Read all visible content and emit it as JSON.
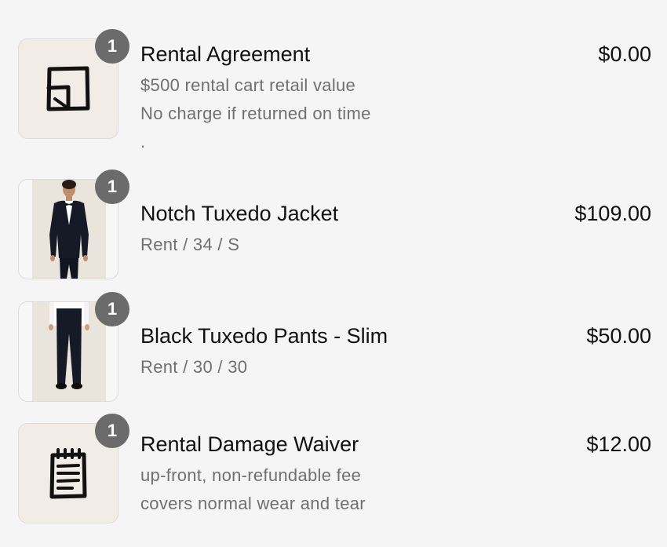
{
  "cart": {
    "items": [
      {
        "quantity": "1",
        "title": "Rental Agreement",
        "details": [
          "$500 rental cart retail value",
          "No charge if returned on time",
          "."
        ],
        "price": "$0.00",
        "thumbnail_icon": "document-corner-icon"
      },
      {
        "quantity": "1",
        "title": "Notch Tuxedo Jacket",
        "details": [
          "Rent / 34 / S"
        ],
        "price": "$109.00",
        "thumbnail_icon": "tuxedo-jacket-photo"
      },
      {
        "quantity": "1",
        "title": "Black Tuxedo Pants - Slim",
        "details": [
          "Rent / 30 / 30"
        ],
        "price": "$50.00",
        "thumbnail_icon": "tuxedo-pants-photo"
      },
      {
        "quantity": "1",
        "title": "Rental Damage Waiver",
        "details": [
          "up-front, non-refundable fee",
          "covers normal wear and tear"
        ],
        "price": "$12.00",
        "thumbnail_icon": "notepad-icon"
      }
    ]
  },
  "colors": {
    "background": "#f5f5f5",
    "badge": "#6b6b6b",
    "thumbnail_background": "#f1ece5",
    "title_text": "#111111",
    "detail_text": "#707070"
  }
}
